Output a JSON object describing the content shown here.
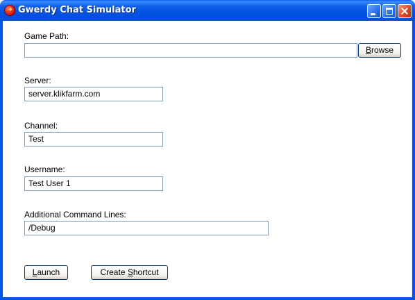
{
  "window": {
    "title": "Gwerdy Chat Simulator"
  },
  "form": {
    "game_path": {
      "label": "Game Path:",
      "value": "",
      "browse_label_pre": "",
      "browse_label_u": "B",
      "browse_label_post": "rowse"
    },
    "server": {
      "label": "Server:",
      "value": "server.klikfarm.com"
    },
    "channel": {
      "label": "Channel:",
      "value": "Test"
    },
    "username": {
      "label": "Username:",
      "value": "Test User 1"
    },
    "command_lines": {
      "label": "Additional Command Lines:",
      "value": "/Debug"
    }
  },
  "actions": {
    "launch_u": "L",
    "launch_rest": "aunch",
    "shortcut_pre": "Create ",
    "shortcut_u": "S",
    "shortcut_post": "hortcut"
  },
  "colors": {
    "titlebar": "#0054e3",
    "field_border": "#7f9db9",
    "button_border": "#003c74"
  }
}
